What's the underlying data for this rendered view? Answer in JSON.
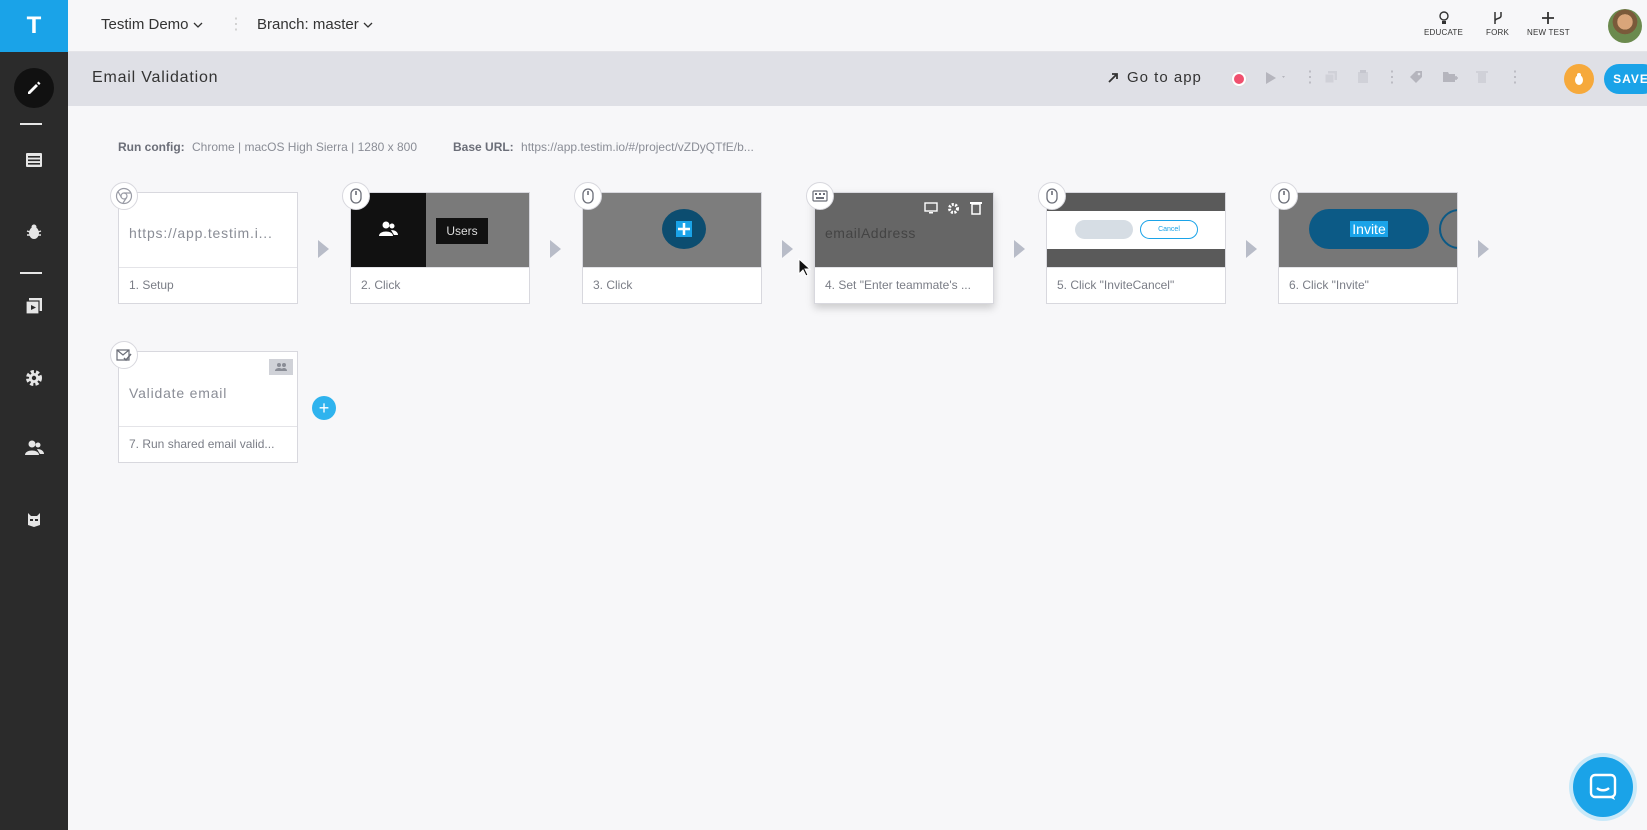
{
  "app": {
    "logo": "T"
  },
  "topbar": {
    "project": "Testim Demo",
    "branch": "Branch: master",
    "actions": [
      {
        "label": "EDUCATE",
        "icon": "lightbulb-icon"
      },
      {
        "label": "FORK",
        "icon": "fork-icon"
      },
      {
        "label": "NEW TEST",
        "icon": "plus-icon"
      }
    ]
  },
  "sidebar": {
    "items": [
      {
        "name": "editor",
        "icon": "pencil-icon",
        "active": true
      },
      {
        "name": "test-list",
        "icon": "list-icon"
      },
      {
        "name": "bugs",
        "icon": "bug-icon"
      },
      {
        "name": "suites",
        "icon": "suites-icon"
      },
      {
        "name": "settings",
        "icon": "gear-icon"
      },
      {
        "name": "users",
        "icon": "users-icon"
      },
      {
        "name": "bot",
        "icon": "mask-icon"
      }
    ]
  },
  "titlebar": {
    "title": "Email Validation",
    "goto_label": "Go to app",
    "save_label": "SAVE"
  },
  "run": {
    "config_label": "Run config:",
    "config_value": "Chrome | macOS High Sierra | 1280 x 800",
    "base_url_label": "Base URL:",
    "base_url_value": "https://app.testim.io/#/project/vZDyQTfE/b..."
  },
  "steps": [
    {
      "label": "1. Setup",
      "thumb_text": "https://app.testim.i...",
      "icon": "chrome-icon"
    },
    {
      "label": "2. Click",
      "thumb_text": "Users",
      "icon": "mouse-icon"
    },
    {
      "label": "3. Click",
      "thumb_text": "",
      "icon": "mouse-icon"
    },
    {
      "label": "4. Set \"Enter teammate's ...",
      "thumb_text": "emailAddress",
      "icon": "keyboard-icon"
    },
    {
      "label": "5. Click \"InviteCancel\"",
      "thumb_text": "Cancel",
      "icon": "mouse-icon"
    },
    {
      "label": "6. Click \"Invite\"",
      "thumb_text": "Invite",
      "icon": "mouse-icon"
    },
    {
      "label": "7. Run shared email valid...",
      "thumb_text": "Validate email",
      "icon": "email-check-icon"
    }
  ],
  "colors": {
    "accent": "#1aa3e8",
    "sidebar": "#2b2b2b",
    "record": "#f0506e",
    "bug": "#f6a93b"
  }
}
